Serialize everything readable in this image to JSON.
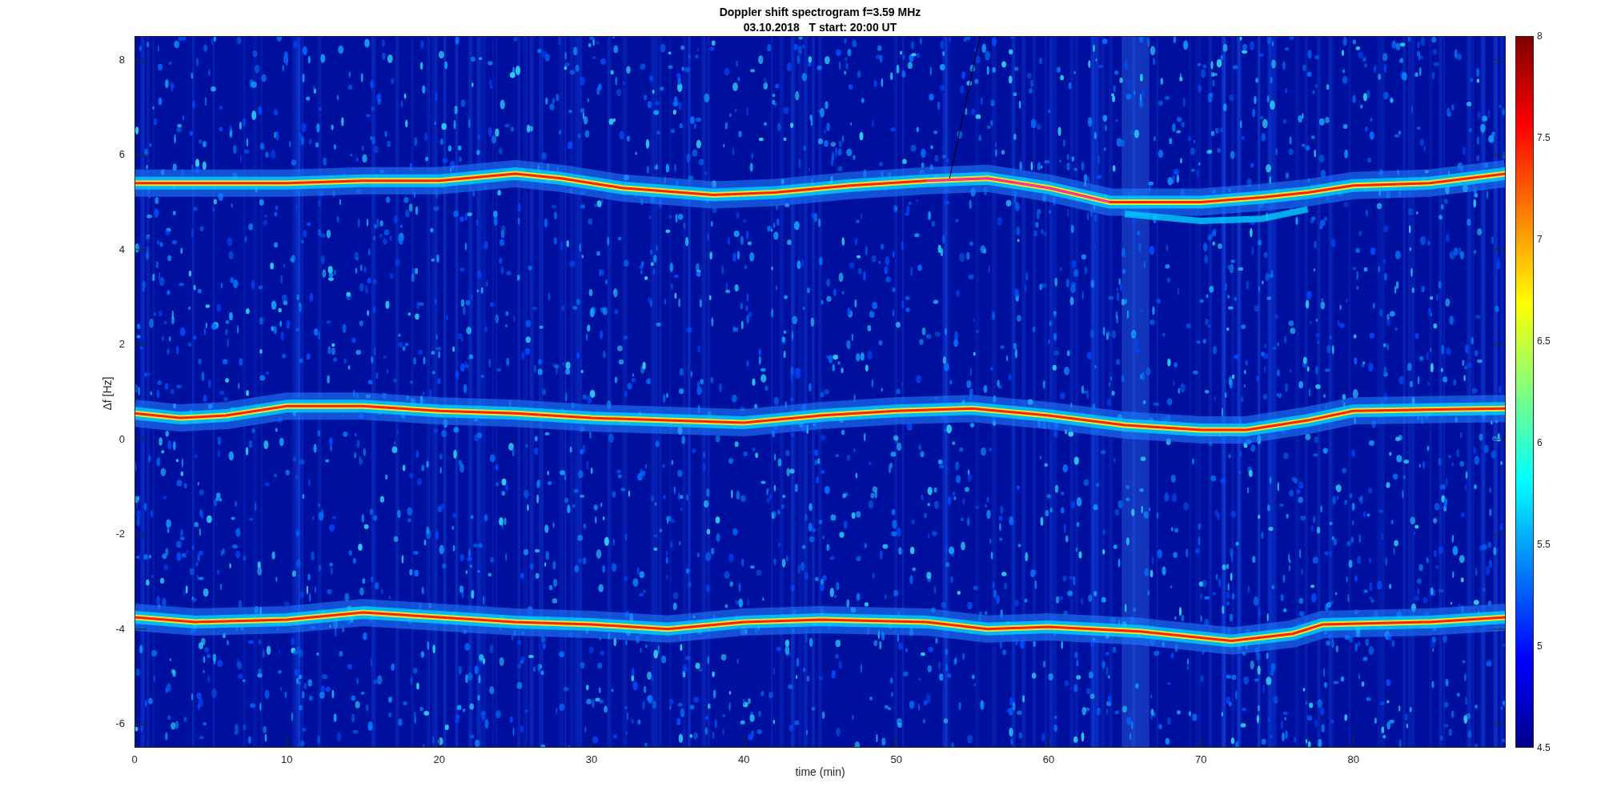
{
  "title": "Doppler shift spectrogram f=3.59 MHz",
  "subtitle": "03.10.2018   T start: 20:00 UT",
  "ylabel": "Δf [Hz]",
  "xlabel": "time (min)",
  "yticks": [
    "8",
    "6",
    "4",
    "2",
    "0",
    "-2",
    "-4",
    "-6"
  ],
  "xticks": [
    "0",
    "10",
    "20",
    "30",
    "40",
    "50",
    "60",
    "70",
    "80"
  ],
  "colorbar_ticks": [
    "8",
    "7.5",
    "7",
    "6.5",
    "6",
    "5.5",
    "5",
    "4.5"
  ]
}
